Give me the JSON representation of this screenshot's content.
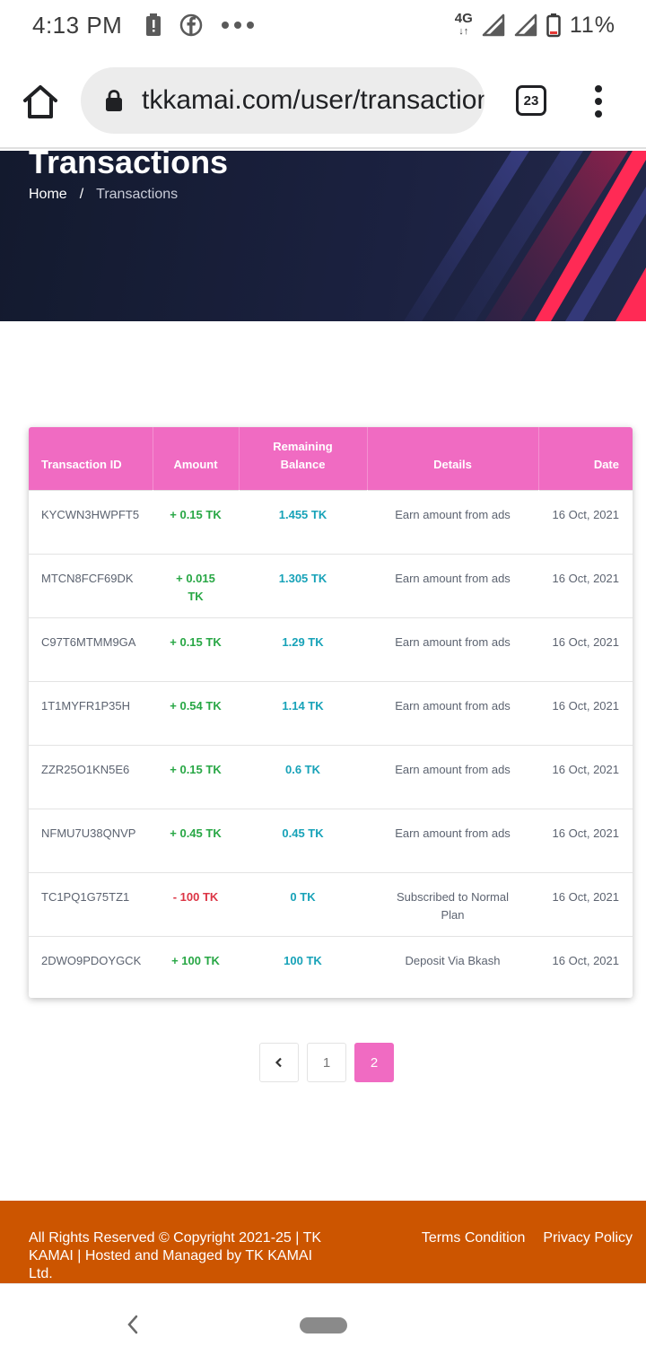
{
  "status_bar": {
    "time": "4:13 PM",
    "network": "4G",
    "battery": "11%",
    "icons": [
      "battery-alert-icon",
      "facebook-icon",
      "more-dots-icon",
      "signal-icon",
      "battery-icon"
    ]
  },
  "browser": {
    "url": "tkkamai.com/user/transactions",
    "tab_count": "23",
    "icons": [
      "home-icon",
      "lock-icon",
      "tabs-icon",
      "menu-icon"
    ]
  },
  "hero": {
    "title": "Transactions",
    "breadcrumb": {
      "home": "Home",
      "separator": "/",
      "current": "Transactions"
    }
  },
  "table": {
    "headers": {
      "id": "Transaction ID",
      "amount": "Amount",
      "balance": "Remaining Balance",
      "details": "Details",
      "date": "Date"
    },
    "rows": [
      {
        "id": "KYCWN3HWPFT5",
        "amount": "+ 0.15 TK",
        "balance": "1.455 TK",
        "details": "Earn amount from ads",
        "date": "16 Oct, 2021",
        "type": "credit"
      },
      {
        "id": "MTCN8FCF69DK",
        "amount": "+ 0.015 TK",
        "balance": "1.305 TK",
        "details": "Earn amount from ads",
        "date": "16 Oct, 2021",
        "type": "credit"
      },
      {
        "id": "C97T6MTMM9GA",
        "amount": "+ 0.15 TK",
        "balance": "1.29 TK",
        "details": "Earn amount from ads",
        "date": "16 Oct, 2021",
        "type": "credit"
      },
      {
        "id": "1T1MYFR1P35H",
        "amount": "+ 0.54 TK",
        "balance": "1.14 TK",
        "details": "Earn amount from ads",
        "date": "16 Oct, 2021",
        "type": "credit"
      },
      {
        "id": "ZZR25O1KN5E6",
        "amount": "+ 0.15 TK",
        "balance": "0.6 TK",
        "details": "Earn amount from ads",
        "date": "16 Oct, 2021",
        "type": "credit"
      },
      {
        "id": "NFMU7U38QNVP",
        "amount": "+ 0.45 TK",
        "balance": "0.45 TK",
        "details": "Earn amount from ads",
        "date": "16 Oct, 2021",
        "type": "credit"
      },
      {
        "id": "TC1PQ1G75TZ1",
        "amount": "- 100 TK",
        "balance": "0 TK",
        "details": "Subscribed to Normal Plan",
        "date": "16 Oct, 2021",
        "type": "debit"
      },
      {
        "id": "2DWO9PDOYGCK",
        "amount": "+ 100 TK",
        "balance": "100 TK",
        "details": "Deposit Via Bkash",
        "date": "16 Oct, 2021",
        "type": "credit"
      }
    ]
  },
  "pagination": {
    "prev_icon": "chevron-left-icon",
    "pages": [
      "1",
      "2"
    ],
    "current": "2"
  },
  "footer": {
    "copyright": "All Rights Reserved © Copyright 2021-25 | TK KAMAI | Hosted and Managed by TK KAMAI Ltd.",
    "links": [
      "Terms Condition",
      "Privacy Policy"
    ]
  },
  "colors": {
    "accent_pink": "#f06bc2",
    "footer_orange": "#cc5500",
    "hero_dark": "#1b2140",
    "positive": "#28a745",
    "negative": "#dc3545",
    "balance_teal": "#17a2b8"
  }
}
